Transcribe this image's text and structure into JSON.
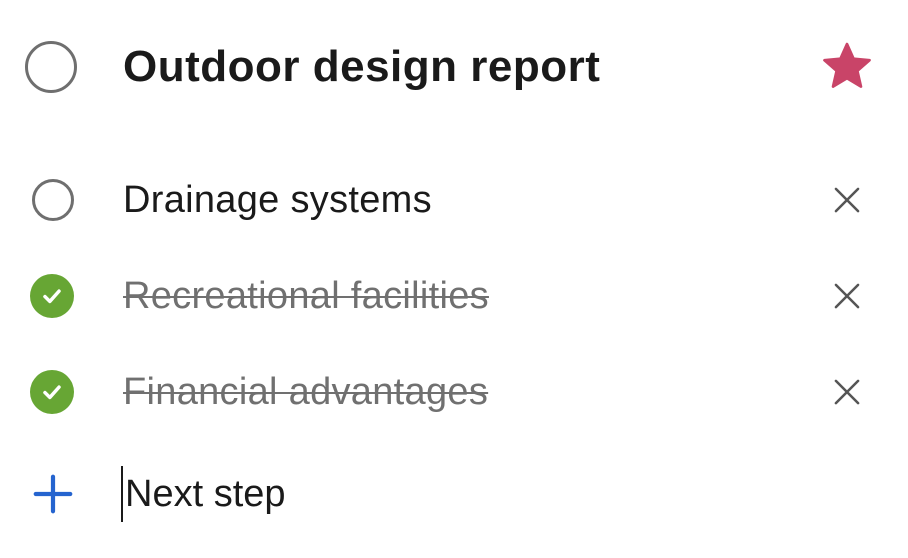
{
  "task": {
    "title": "Outdoor design report",
    "important": true,
    "star_color": "#c94468",
    "check_color": "#67a634",
    "accent_color": "#2564cf"
  },
  "steps": [
    {
      "label": "Drainage systems",
      "completed": false
    },
    {
      "label": "Recreational facilities",
      "completed": true
    },
    {
      "label": "Financial advantages",
      "completed": true
    }
  ],
  "next_step": {
    "placeholder": "Next step"
  },
  "icons": {
    "complete": "circle-icon",
    "completed": "checkmark-circle-icon",
    "important": "star-icon",
    "remove": "close-icon",
    "add": "plus-icon"
  }
}
